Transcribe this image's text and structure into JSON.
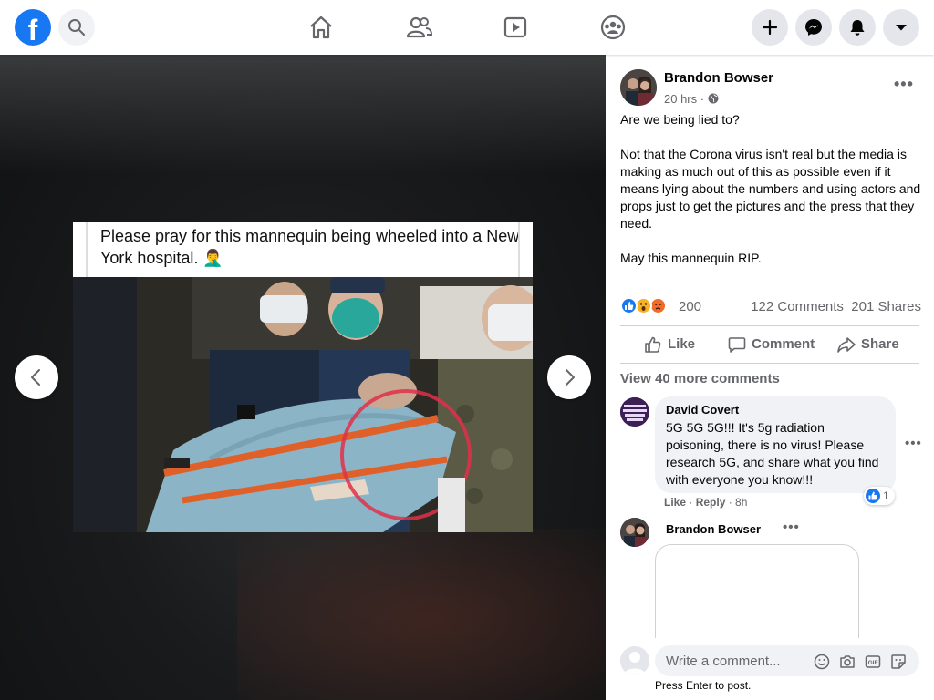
{
  "app": {
    "name": "Facebook",
    "logo_letter": "f",
    "accent_color": "#1877f2"
  },
  "topbar": {
    "left_icons": [
      "facebook-logo",
      "search-icon"
    ],
    "nav_icons": [
      "home-icon",
      "friends-icon",
      "watch-icon",
      "groups-icon"
    ],
    "right_icons": [
      "plus-icon",
      "messenger-icon",
      "notifications-bell-icon",
      "account-menu-chevron-icon"
    ]
  },
  "viewer": {
    "caption": "Please pray for this mannequin being wheeled into a New York hospital. 🤦‍♂️",
    "prev_icon": "chevron-left-icon",
    "next_icon": "chevron-right-icon"
  },
  "post": {
    "author": "Brandon Bowser",
    "time": "20 hrs",
    "separator": "·",
    "privacy_icon": "globe-icon",
    "more_icon": "•••",
    "text": "Are we being lied to?\n\nNot that the Corona virus isn't real but the media is making as much out of this as possible even if it means lying about the numbers and using actors and props just to get the pictures and the press that they need.\n\nMay this mannequin RIP.",
    "reactions": {
      "types": [
        "like",
        "wow",
        "angry"
      ],
      "count": "200"
    },
    "comments_count": "122 Comments",
    "shares_count": "201 Shares",
    "actions": {
      "like": "Like",
      "comment": "Comment",
      "share": "Share"
    }
  },
  "comments": {
    "view_more": "View 40 more comments",
    "items": [
      {
        "name": "David Covert",
        "text": "5G 5G 5G!!! It's 5g radiation poisoning, there is no virus! Please research 5G, and share what you find with everyone you know!!!",
        "like": "Like",
        "reply": "Reply",
        "time": "8h",
        "like_badge_count": "1",
        "more_icon": "•••"
      },
      {
        "name": "Brandon Bowser",
        "more_icon": "•••"
      }
    ]
  },
  "composer": {
    "placeholder": "Write a comment...",
    "icons": [
      "emoji-icon",
      "camera-icon",
      "gif-icon",
      "sticker-icon"
    ],
    "gif_label": "GIF",
    "hint": "Press Enter to post."
  }
}
